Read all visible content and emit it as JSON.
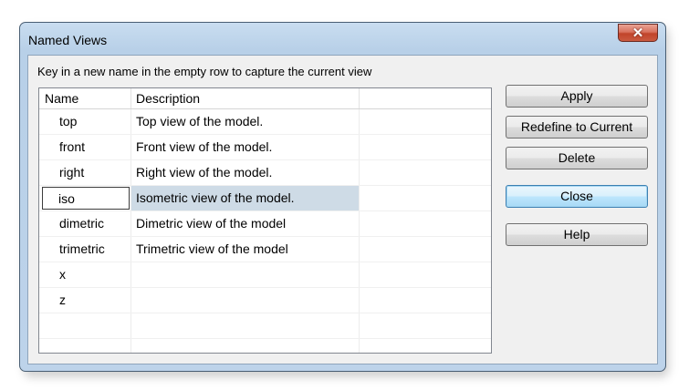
{
  "window": {
    "title": "Named Views",
    "close_glyph": "✕"
  },
  "instruction": "Key in a new name in the empty row to capture the current view",
  "grid": {
    "columns": [
      "Name",
      "Description",
      ""
    ],
    "rows": [
      {
        "name": "top",
        "description": "Top view of the model."
      },
      {
        "name": "front",
        "description": "Front view of the model."
      },
      {
        "name": "right",
        "description": "Right view of the model."
      },
      {
        "name": "iso",
        "description": "Isometric view of the model.",
        "selected": true,
        "editing": true
      },
      {
        "name": "dimetric",
        "description": "Dimetric view of the model"
      },
      {
        "name": "trimetric",
        "description": "Trimetric view of the model"
      },
      {
        "name": "x",
        "description": ""
      },
      {
        "name": "z",
        "description": ""
      },
      {
        "name": "",
        "description": ""
      }
    ]
  },
  "buttons": {
    "apply": "Apply",
    "redefine": "Redefine to Current",
    "delete": "Delete",
    "close": "Close",
    "help": "Help"
  },
  "colors": {
    "selection": "#cedbe6",
    "title_bar": "#c9ddf0",
    "close_button": "#c1442b",
    "default_button_border": "#3c7fb1"
  }
}
